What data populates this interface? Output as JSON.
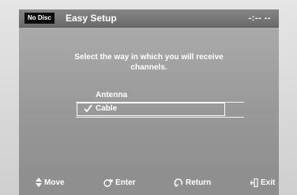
{
  "header": {
    "disc_status": "No Disc",
    "title": "Easy Setup",
    "clock": "-:-- --"
  },
  "setup": {
    "prompt": "Select the way in which you will receive channels.",
    "options": [
      {
        "label": "Antenna",
        "selected": false
      },
      {
        "label": "Cable",
        "selected": true
      }
    ]
  },
  "footer": {
    "hints": [
      {
        "icon": "up-down-arrow-icon",
        "label": "Move"
      },
      {
        "icon": "enter-icon",
        "label": "Enter"
      },
      {
        "icon": "return-icon",
        "label": "Return"
      },
      {
        "icon": "exit-icon",
        "label": "Exit"
      }
    ]
  },
  "colors": {
    "title_bar": "#777777",
    "panel": "#9f9f9f",
    "footer": "#8f8f8f",
    "text": "#ffffff"
  }
}
